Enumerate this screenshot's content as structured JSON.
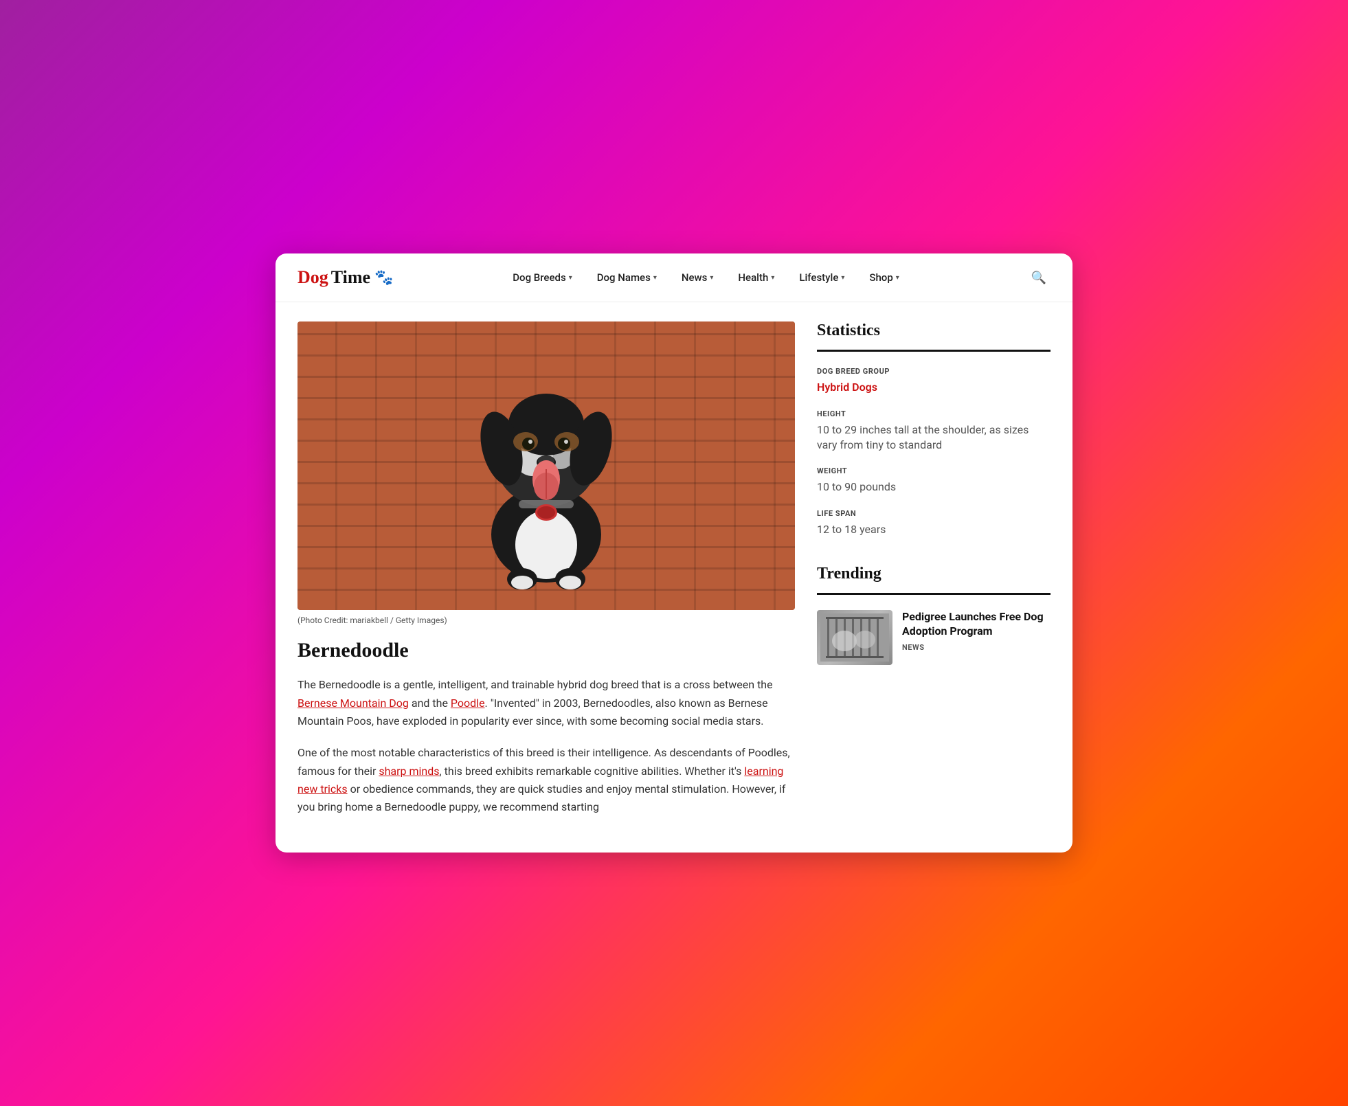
{
  "brand": {
    "logo_dog": "Dog",
    "logo_time": "Time",
    "logo_paw": "🐾"
  },
  "nav": {
    "items": [
      {
        "label": "Dog Breeds",
        "has_dropdown": true
      },
      {
        "label": "Dog Names",
        "has_dropdown": true
      },
      {
        "label": "News",
        "has_dropdown": true
      },
      {
        "label": "Health",
        "has_dropdown": true
      },
      {
        "label": "Lifestyle",
        "has_dropdown": true
      },
      {
        "label": "Shop",
        "has_dropdown": true
      }
    ]
  },
  "article": {
    "photo_credit": "(Photo Credit: mariakbell / Getty Images)",
    "title": "Bernedoodle",
    "paragraphs": [
      "The Bernedoodle is a gentle, intelligent, and trainable hybrid dog breed that is a cross between the Bernese Mountain Dog and the Poodle. \"Invented\" in 2003, Bernedoodles, also known as Bernese Mountain Poos, have exploded in popularity ever since, with some becoming social media stars.",
      "One of the most notable characteristics of this breed is their intelligence. As descendants of Poodles, famous for their sharp minds, this breed exhibits remarkable cognitive abilities. Whether it's learning new tricks or obedience commands, they are quick studies and enjoy mental stimulation. However, if you bring home a Bernedoodle puppy, we recommend starting"
    ],
    "links": [
      {
        "text": "Bernese Mountain Dog",
        "href": "#"
      },
      {
        "text": "Poodle",
        "href": "#"
      },
      {
        "text": "sharp minds",
        "href": "#"
      },
      {
        "text": "learning new tricks",
        "href": "#"
      }
    ]
  },
  "statistics": {
    "section_title": "Statistics",
    "items": [
      {
        "label": "DOG BREED GROUP",
        "value": "Hybrid Dogs",
        "highlight": true
      },
      {
        "label": "HEIGHT",
        "value": "10 to 29 inches tall at the shoulder, as sizes vary from tiny to standard",
        "highlight": false
      },
      {
        "label": "WEIGHT",
        "value": "10 to 90 pounds",
        "highlight": false
      },
      {
        "label": "LIFE SPAN",
        "value": "12 to 18 years",
        "highlight": false
      }
    ]
  },
  "trending": {
    "section_title": "Trending",
    "items": [
      {
        "title": "Pedigree Launches Free Dog Adoption Program",
        "tag": "NEWS"
      }
    ]
  }
}
